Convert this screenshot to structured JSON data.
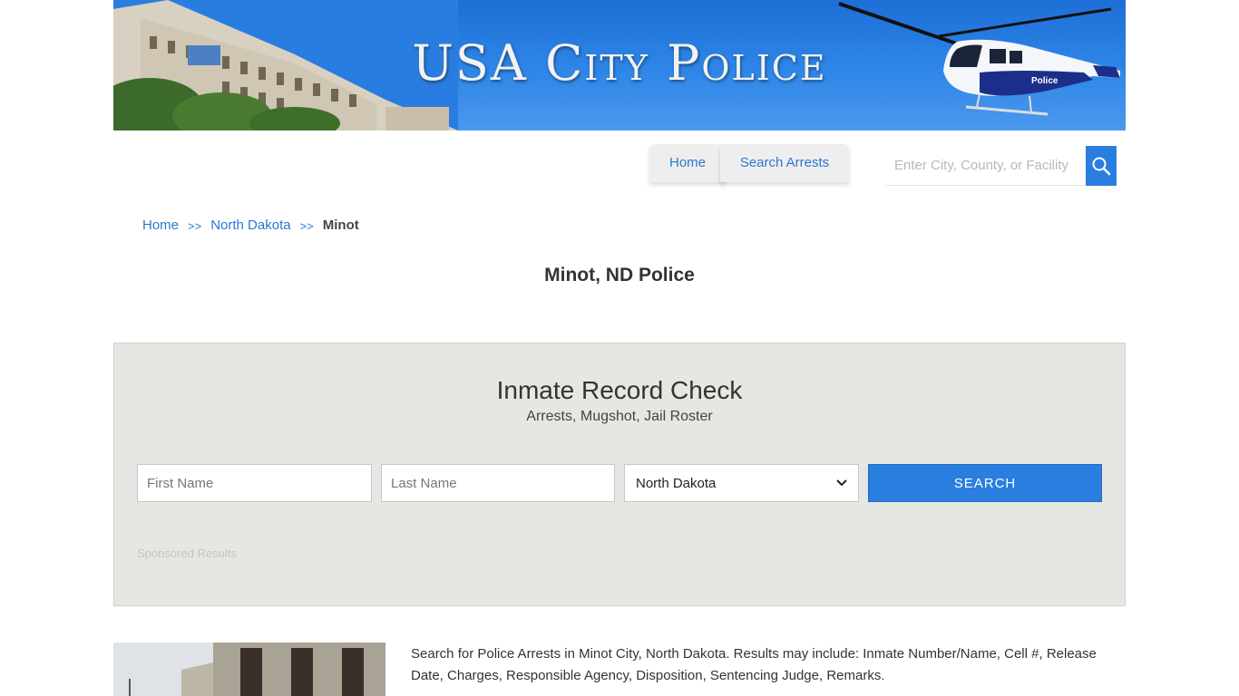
{
  "banner": {
    "title": "USA City Police",
    "heli_label": "Police"
  },
  "nav": {
    "home_label": "Home",
    "search_arrests_label": "Search Arrests",
    "search_placeholder": "Enter City, County, or Facility"
  },
  "breadcrumb": {
    "home": "Home",
    "sep": ">>",
    "state": "North Dakota",
    "current": "Minot"
  },
  "page_title": "Minot, ND Police",
  "record_check": {
    "title": "Inmate Record Check",
    "subtitle": "Arrests, Mugshot, Jail Roster",
    "first_name_placeholder": "First Name",
    "last_name_placeholder": "Last Name",
    "state_selected": "North Dakota",
    "search_label": "SEARCH",
    "sponsored": "Sponsored Results"
  },
  "description": "Search for Police Arrests in Minot City, North Dakota. Results may include: Inmate Number/Name, Cell #, Release Date, Charges, Responsible Agency, Disposition, Sentencing Judge, Remarks.",
  "colors": {
    "accent": "#2a7ee0",
    "link": "#2a77d2",
    "panel_bg": "#e8e6e2"
  },
  "icons": {
    "search": "search-icon",
    "dropdown": "chevron-down-icon"
  }
}
